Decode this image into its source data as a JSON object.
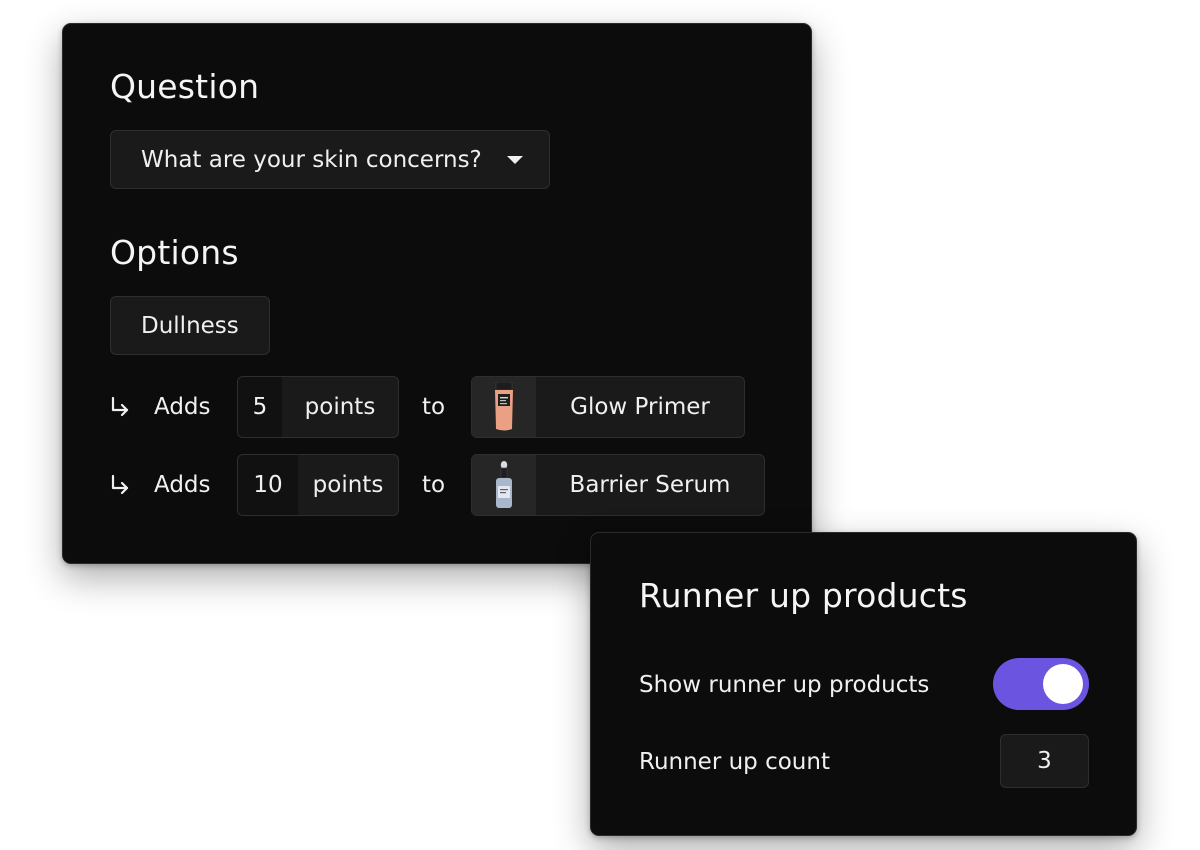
{
  "question": {
    "heading": "Question",
    "selected": "What are your skin concerns?"
  },
  "options": {
    "heading": "Options",
    "selected_option": "Dullness",
    "rules": [
      {
        "adds_label": "Adds",
        "points": "5",
        "points_label": "points",
        "to_label": "to",
        "product": "Glow Primer",
        "product_icon": "primer-tube-thumbnail"
      },
      {
        "adds_label": "Adds",
        "points": "10",
        "points_label": "points",
        "to_label": "to",
        "product": "Barrier Serum",
        "product_icon": "serum-bottle-thumbnail"
      }
    ]
  },
  "runner_up": {
    "heading": "Runner up products",
    "show_label": "Show runner up products",
    "show_enabled": true,
    "count_label": "Runner up count",
    "count_value": "3"
  },
  "colors": {
    "panel_background": "#0c0c0c",
    "toggle_on": "#6b54df",
    "field_background": "#1a1a1a"
  }
}
